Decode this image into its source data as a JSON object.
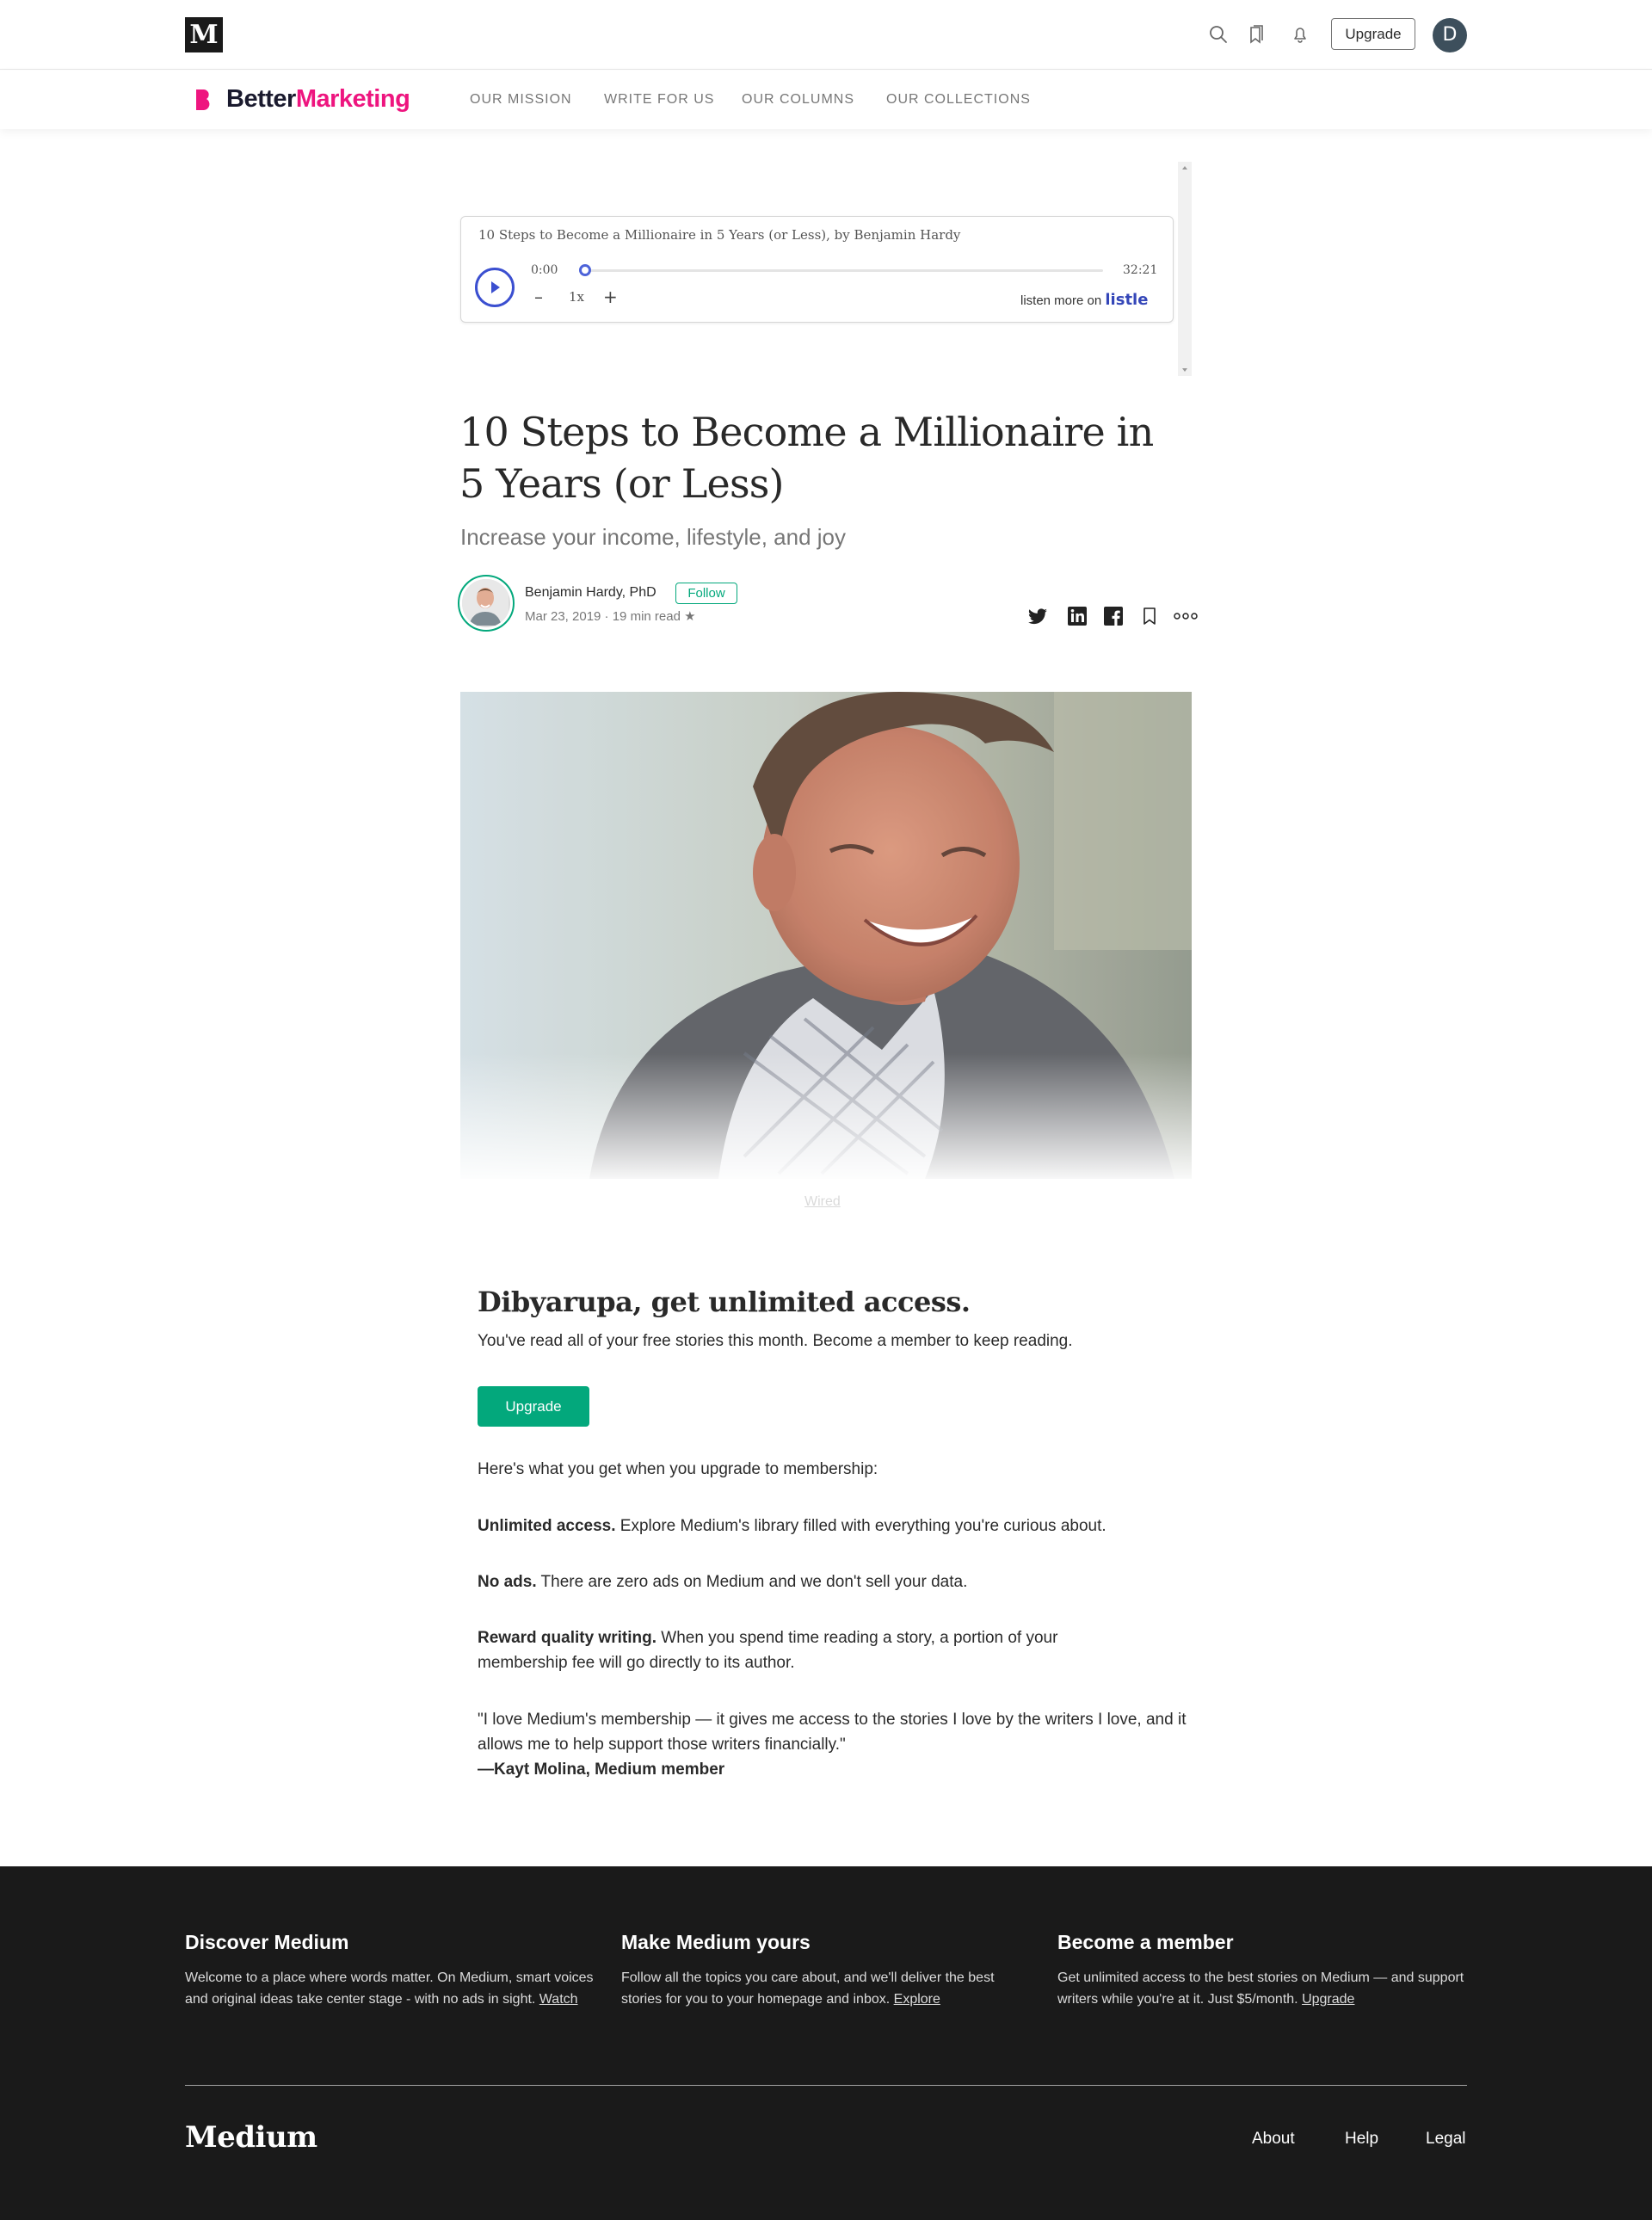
{
  "topbar": {
    "logo": "M",
    "icons": [
      "search-icon",
      "bookmarks-icon",
      "notifications-icon"
    ],
    "upgrade_label": "Upgrade",
    "avatar_initial": "D"
  },
  "publication": {
    "name_part1": "Better",
    "name_part2": "Marketing",
    "brand_color": "#ee157f",
    "nav": [
      "OUR MISSION",
      "WRITE FOR US",
      "OUR COLUMNS",
      "OUR COLLECTIONS"
    ]
  },
  "audio": {
    "title": "10 Steps to Become a Millionaire in 5 Years (or Less), by Benjamin Hardy",
    "time_start": "0:00",
    "time_end": "32:21",
    "speed": "1x",
    "speed_minus": "–",
    "speed_plus": "+",
    "listen_more": "listen more on",
    "brand": "listle",
    "progress": 0
  },
  "article": {
    "title": "10 Steps to Become a Millionaire in 5 Years (or Less)",
    "subtitle": "Increase your income, lifestyle, and joy",
    "author": "Benjamin Hardy, PhD",
    "follow_label": "Follow",
    "meta": "Mar 23, 2019 · 19 min read ★",
    "share_icons": [
      "twitter-icon",
      "linkedin-icon",
      "facebook-icon",
      "bookmark-icon",
      "more-icon"
    ],
    "image_caption": "Wired"
  },
  "paywall": {
    "title": "Dibyarupa, get unlimited access.",
    "subtitle": "You've read all of your free stories this month. Become a member to keep reading.",
    "upgrade_label": "Upgrade",
    "intro": "Here's what you get when you upgrade to membership:",
    "benefits": [
      {
        "bold": "Unlimited access.",
        "text": " Explore Medium's library filled with everything you're curious about."
      },
      {
        "bold": "No ads.",
        "text": " There are zero ads on Medium and we don't sell your data."
      },
      {
        "bold": "Reward quality writing.",
        "text": " When you spend time reading a story, a portion of your membership fee will go directly to its author."
      }
    ],
    "quote": "\"I love Medium's membership — it gives me access to the stories I love by the writers I love, and it allows me to help support those writers financially.\"",
    "quote_author": "—Kayt Molina, Medium member"
  },
  "footer": {
    "columns": [
      {
        "title": "Discover Medium",
        "text": "Welcome to a place where words matter. On Medium, smart voices and original ideas take center stage - with no ads in sight. ",
        "link": "Watch"
      },
      {
        "title": "Make Medium yours",
        "text": "Follow all the topics you care about, and we'll deliver the best stories for you to your homepage and inbox. ",
        "link": "Explore"
      },
      {
        "title": "Become a member",
        "text": "Get unlimited access to the best stories on Medium — and support writers while you're at it. Just $5/month. ",
        "link": "Upgrade"
      }
    ],
    "logo": "Medium",
    "links": [
      "About",
      "Help",
      "Legal"
    ]
  }
}
